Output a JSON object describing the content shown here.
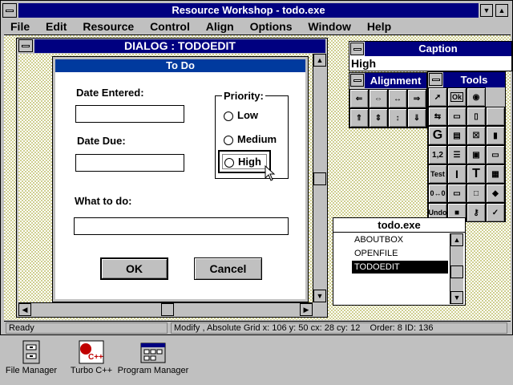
{
  "window": {
    "title": "Resource Workshop - todo.exe"
  },
  "menu": [
    "File",
    "Edit",
    "Resource",
    "Control",
    "Align",
    "Options",
    "Window",
    "Help"
  ],
  "dialog_editor": {
    "title": "DIALOG : TODOEDIT"
  },
  "dialog": {
    "title": "To Do",
    "date_entered_label": "Date Entered:",
    "date_due_label": "Date Due:",
    "priority_label": "Priority:",
    "priority_options": [
      "Low",
      "Medium",
      "High"
    ],
    "what_to_do_label": "What to do:",
    "ok_label": "OK",
    "cancel_label": "Cancel"
  },
  "caption_panel": {
    "title": "Caption",
    "value": "High"
  },
  "alignment_panel": {
    "title": "Alignment"
  },
  "tools_panel": {
    "title": "Tools",
    "labels": {
      "ok": "Ok",
      "numbers": "1,2",
      "test": "Test",
      "undo": "Undo"
    }
  },
  "resource_list": {
    "title": "todo.exe",
    "items": [
      "ABOUTBOX",
      "OPENFILE",
      "TODOEDIT"
    ],
    "selected": "TODOEDIT"
  },
  "status": {
    "left": "Ready",
    "right": "Modify , Absolute Grid x: 106 y: 50 cx: 28 cy: 12    Order: 8 ID: 136"
  },
  "desktop_icons": [
    "File Manager",
    "Turbo C++",
    "Program Manager"
  ],
  "colors": {
    "titlebar": "#000080",
    "selection": "#000000",
    "desktop": "#c0c0c0"
  }
}
